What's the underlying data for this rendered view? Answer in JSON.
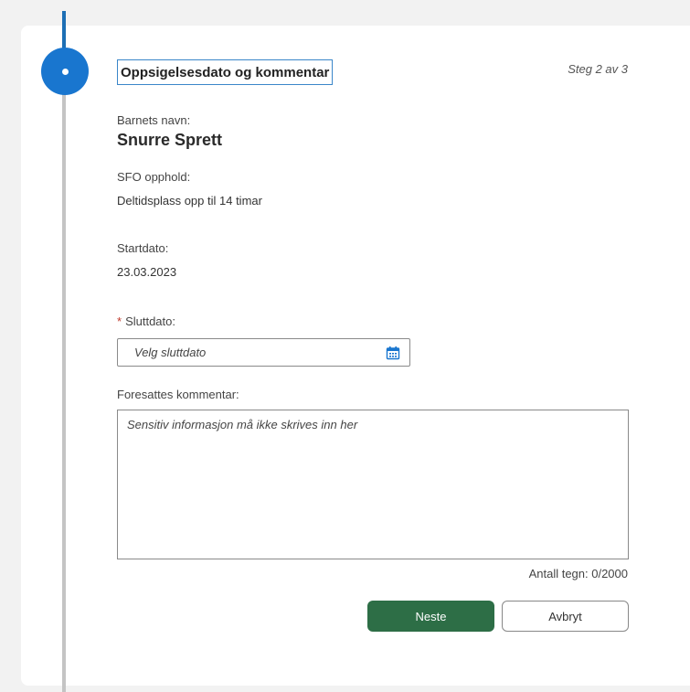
{
  "section": {
    "title": "Oppsigelsesdato og kommentar",
    "step_counter": "Steg 2 av 3"
  },
  "child": {
    "label": "Barnets navn:",
    "name": "Snurre Sprett"
  },
  "sfo": {
    "label": "SFO opphold:",
    "value": "Deltidsplass opp til 14 timar"
  },
  "start_date": {
    "label": "Startdato:",
    "value": "23.03.2023"
  },
  "end_date": {
    "required_marker": "*",
    "label": "Sluttdato:",
    "placeholder": "Velg sluttdato",
    "value": "",
    "icon": "calendar-icon"
  },
  "comment": {
    "label": "Foresattes kommentar:",
    "placeholder": "Sensitiv informasjon må ikke skrives inn her",
    "value": "",
    "char_count": "Antall tegn: 0/2000"
  },
  "buttons": {
    "next": "Neste",
    "cancel": "Avbryt"
  },
  "colors": {
    "timeline_active": "#1976cf",
    "timeline_inactive": "#c4c4c4",
    "primary_button": "#2d6e46",
    "required_marker": "#c0392b",
    "calendar_icon": "#1976cf"
  }
}
